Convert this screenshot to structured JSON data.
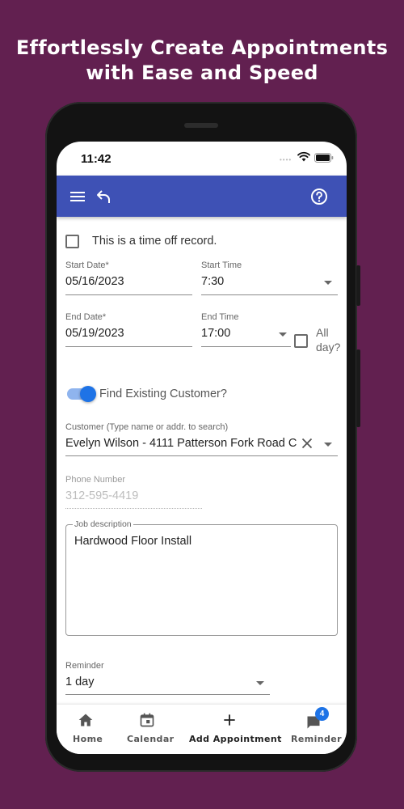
{
  "promo": {
    "line1": "Effortlessly Create Appointments",
    "line2": "with Ease and Speed"
  },
  "status_bar": {
    "time": "11:42",
    "dots": "••••"
  },
  "app_bar": {
    "color": "#3e51b5",
    "icons": [
      "menu-icon",
      "undo-icon",
      "help-icon"
    ]
  },
  "form": {
    "time_off_label": "This is a time off record.",
    "time_off_checked": false,
    "start_date": {
      "label": "Start Date*",
      "value": "05/16/2023"
    },
    "start_time": {
      "label": "Start Time",
      "value": "7:30"
    },
    "end_date": {
      "label": "End Date*",
      "value": "05/19/2023"
    },
    "end_time": {
      "label": "End Time",
      "value": "17:00"
    },
    "all_day": {
      "label_line1": "All",
      "label_line2": "day?",
      "checked": false
    },
    "find_existing": {
      "label": "Find Existing Customer?",
      "on": true
    },
    "customer": {
      "label": "Customer (Type name or addr. to search)",
      "value": "Evelyn Wilson - 4111 Patterson Fork Road C"
    },
    "phone": {
      "label": "Phone Number",
      "placeholder": "312-595-4419"
    },
    "job_description": {
      "label": "Job description",
      "value": "Hardwood Floor Install"
    },
    "reminder": {
      "label": "Reminder",
      "value": "1 day"
    }
  },
  "bottom_nav": {
    "items": [
      {
        "label": "Home",
        "icon": "home-icon"
      },
      {
        "label": "Calendar",
        "icon": "calendar-icon"
      },
      {
        "label": "Add Appointment",
        "icon": "plus-icon"
      },
      {
        "label": "Reminder",
        "icon": "chat-icon",
        "badge": "4"
      }
    ]
  },
  "colors": {
    "background": "#622050",
    "accent": "#1e73e6",
    "app_bar": "#3e51b5"
  }
}
